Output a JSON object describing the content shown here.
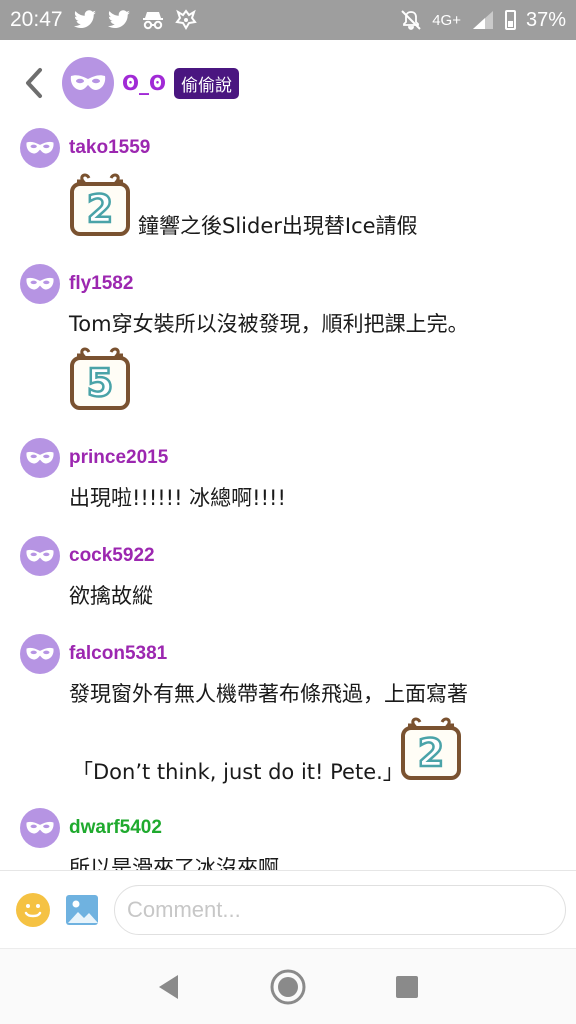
{
  "status_bar": {
    "time": "20:47",
    "network": "4G+",
    "battery": "37%",
    "icons": [
      "twitter-icon",
      "twitter-icon",
      "incognito-icon",
      "app-icon",
      "mute-icon",
      "signal-icon",
      "battery-icon"
    ]
  },
  "header": {
    "name": "ʘ_ʘ",
    "badge": "偷偷說"
  },
  "posts": [
    {
      "user": "tako1559",
      "user_color": "#9c27b0",
      "lines": [
        "鐘響之後Slider出現替Ice請假"
      ],
      "sticker": "2"
    },
    {
      "user": "fly1582",
      "user_color": "#9c27b0",
      "lines": [
        "Tom穿女裝所以沒被發現，順利把課上完。"
      ],
      "sticker": "5"
    },
    {
      "user": "prince2015",
      "user_color": "#9c27b0",
      "lines": [
        "出現啦!!!!!! 冰總啊!!!!"
      ]
    },
    {
      "user": "cock5922",
      "user_color": "#9c27b0",
      "lines": [
        "欲擒故縱"
      ]
    },
    {
      "user": "falcon5381",
      "user_color": "#9c27b0",
      "lines": [
        "發現窗外有無人機帶著布條飛過，上面寫著",
        "「Don’t think, just do it! Pete.」"
      ],
      "sticker": "2"
    },
    {
      "user": "dwarf5402",
      "user_color": "#1faa2e",
      "lines": [
        "所以是滑來了冰沒來啊"
      ]
    }
  ],
  "composer": {
    "placeholder": "Comment..."
  },
  "colors": {
    "avatar": "#b694e3",
    "badge": "#4a1680",
    "status_bar": "#9e9e9e"
  }
}
